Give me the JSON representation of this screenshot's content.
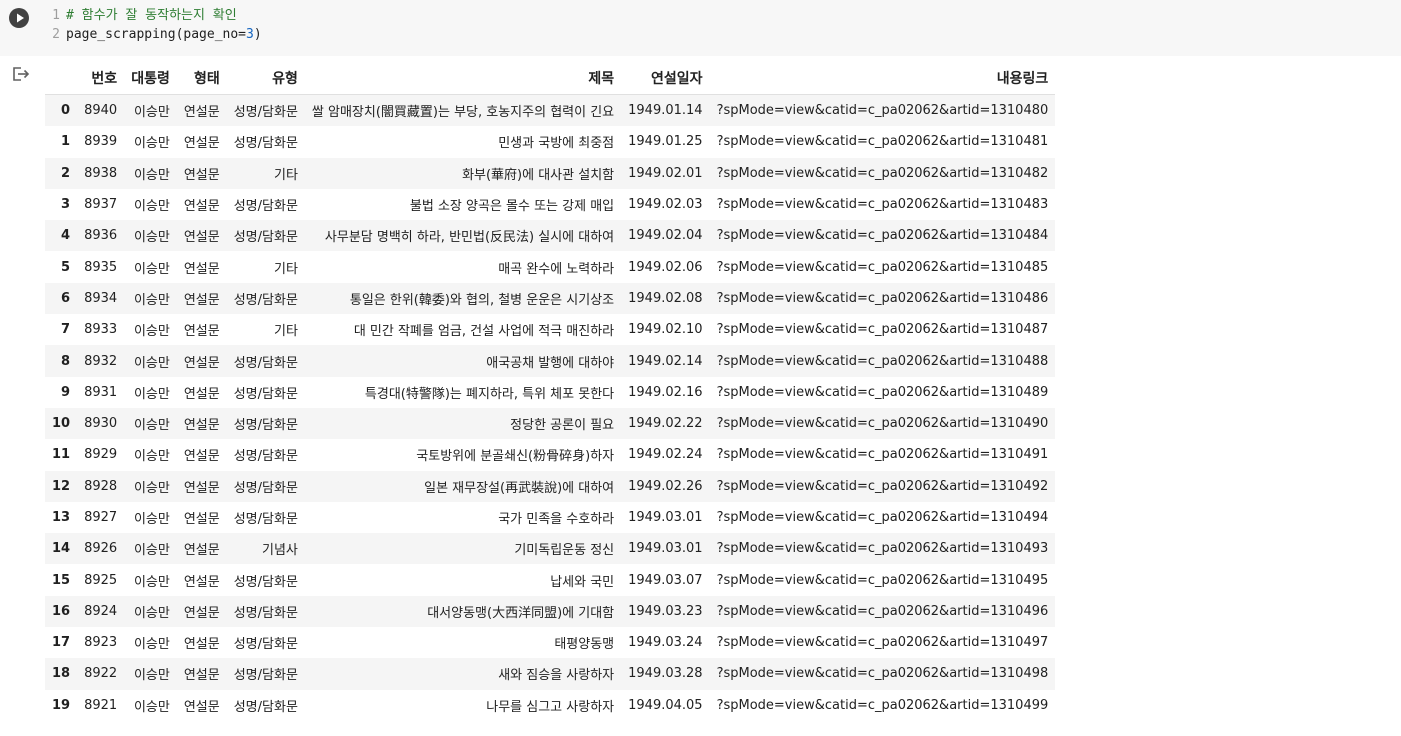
{
  "code_cell": {
    "lines": [
      {
        "num": "1",
        "comment": "# 함수가 잘 동작하는지 확인"
      },
      {
        "num": "2",
        "code_prefix": "page_scrapping(page_no=",
        "code_number": "3",
        "code_suffix": ")"
      }
    ]
  },
  "table": {
    "headers": [
      "",
      "번호",
      "대통령",
      "형태",
      "유형",
      "제목",
      "연설일자",
      "내용링크"
    ],
    "rows": [
      [
        "0",
        "8940",
        "이승만",
        "연설문",
        "성명/담화문",
        "쌀 암매장치(闇買藏置)는 부당, 호농지주의 협력이 긴요",
        "1949.01.14",
        "?spMode=view&catid=c_pa02062&artid=1310480"
      ],
      [
        "1",
        "8939",
        "이승만",
        "연설문",
        "성명/담화문",
        "민생과 국방에 최중점",
        "1949.01.25",
        "?spMode=view&catid=c_pa02062&artid=1310481"
      ],
      [
        "2",
        "8938",
        "이승만",
        "연설문",
        "기타",
        "화부(華府)에 대사관 설치함",
        "1949.02.01",
        "?spMode=view&catid=c_pa02062&artid=1310482"
      ],
      [
        "3",
        "8937",
        "이승만",
        "연설문",
        "성명/담화문",
        "불법 소장 양곡은 몰수 또는 강제 매입",
        "1949.02.03",
        "?spMode=view&catid=c_pa02062&artid=1310483"
      ],
      [
        "4",
        "8936",
        "이승만",
        "연설문",
        "성명/담화문",
        "사무분담 명백히 하라, 반민법(反民法) 실시에 대하여",
        "1949.02.04",
        "?spMode=view&catid=c_pa02062&artid=1310484"
      ],
      [
        "5",
        "8935",
        "이승만",
        "연설문",
        "기타",
        "매곡 완수에 노력하라",
        "1949.02.06",
        "?spMode=view&catid=c_pa02062&artid=1310485"
      ],
      [
        "6",
        "8934",
        "이승만",
        "연설문",
        "성명/담화문",
        "통일은 한위(韓委)와 협의, 철병 운운은 시기상조",
        "1949.02.08",
        "?spMode=view&catid=c_pa02062&artid=1310486"
      ],
      [
        "7",
        "8933",
        "이승만",
        "연설문",
        "기타",
        "대 민간 작폐를 엄금, 건설 사업에 적극 매진하라",
        "1949.02.10",
        "?spMode=view&catid=c_pa02062&artid=1310487"
      ],
      [
        "8",
        "8932",
        "이승만",
        "연설문",
        "성명/담화문",
        "애국공채 발행에 대하야",
        "1949.02.14",
        "?spMode=view&catid=c_pa02062&artid=1310488"
      ],
      [
        "9",
        "8931",
        "이승만",
        "연설문",
        "성명/담화문",
        "특경대(特警隊)는 폐지하라, 특위 체포 못한다",
        "1949.02.16",
        "?spMode=view&catid=c_pa02062&artid=1310489"
      ],
      [
        "10",
        "8930",
        "이승만",
        "연설문",
        "성명/담화문",
        "정당한 공론이 필요",
        "1949.02.22",
        "?spMode=view&catid=c_pa02062&artid=1310490"
      ],
      [
        "11",
        "8929",
        "이승만",
        "연설문",
        "성명/담화문",
        "국토방위에 분골쇄신(粉骨碎身)하자",
        "1949.02.24",
        "?spMode=view&catid=c_pa02062&artid=1310491"
      ],
      [
        "12",
        "8928",
        "이승만",
        "연설문",
        "성명/담화문",
        "일본 재무장설(再武裝說)에 대하여",
        "1949.02.26",
        "?spMode=view&catid=c_pa02062&artid=1310492"
      ],
      [
        "13",
        "8927",
        "이승만",
        "연설문",
        "성명/담화문",
        "국가 민족을 수호하라",
        "1949.03.01",
        "?spMode=view&catid=c_pa02062&artid=1310494"
      ],
      [
        "14",
        "8926",
        "이승만",
        "연설문",
        "기념사",
        "기미독립운동 정신",
        "1949.03.01",
        "?spMode=view&catid=c_pa02062&artid=1310493"
      ],
      [
        "15",
        "8925",
        "이승만",
        "연설문",
        "성명/담화문",
        "납세와 국민",
        "1949.03.07",
        "?spMode=view&catid=c_pa02062&artid=1310495"
      ],
      [
        "16",
        "8924",
        "이승만",
        "연설문",
        "성명/담화문",
        "대서양동맹(大西洋同盟)에 기대함",
        "1949.03.23",
        "?spMode=view&catid=c_pa02062&artid=1310496"
      ],
      [
        "17",
        "8923",
        "이승만",
        "연설문",
        "성명/담화문",
        "태평양동맹",
        "1949.03.24",
        "?spMode=view&catid=c_pa02062&artid=1310497"
      ],
      [
        "18",
        "8922",
        "이승만",
        "연설문",
        "성명/담화문",
        "새와 짐승을 사랑하자",
        "1949.03.28",
        "?spMode=view&catid=c_pa02062&artid=1310498"
      ],
      [
        "19",
        "8921",
        "이승만",
        "연설문",
        "성명/담화문",
        "나무를 심그고 사랑하자",
        "1949.04.05",
        "?spMode=view&catid=c_pa02062&artid=1310499"
      ]
    ]
  },
  "icons": {
    "run": "play-icon",
    "output": "output-redirect-icon"
  }
}
